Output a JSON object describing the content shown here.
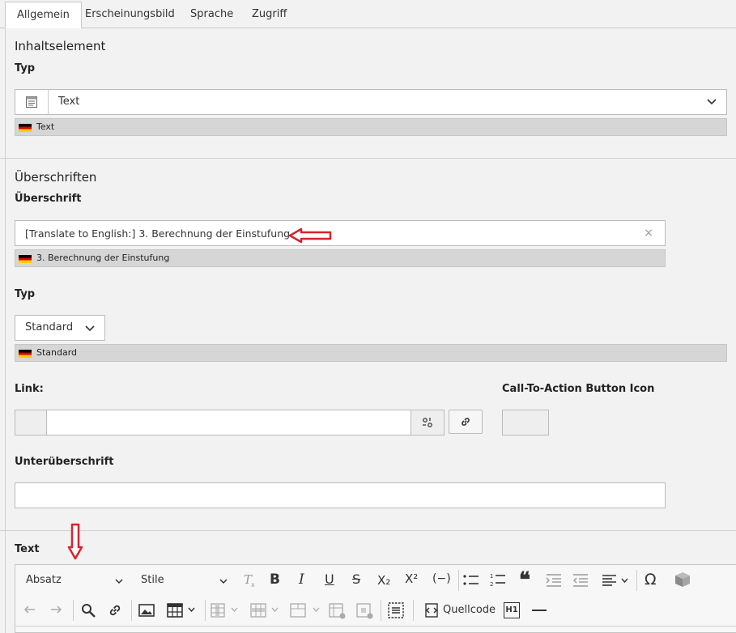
{
  "tabs": [
    {
      "label": "Allgemein",
      "active": true
    },
    {
      "label": "Erscheinungsbild"
    },
    {
      "label": "Sprache"
    },
    {
      "label": "Zugriff"
    }
  ],
  "section_content": {
    "title": "Inhaltselement"
  },
  "type_field": {
    "label": "Typ",
    "value": "Text",
    "fallback": "Text"
  },
  "section_headings": {
    "title": "Überschriften"
  },
  "heading_field": {
    "label": "Überschrift",
    "value": "[Translate to English:] 3. Berechnung der Einstufung",
    "fallback": "3. Berechnung der Einstufung"
  },
  "heading_type": {
    "label": "Typ",
    "value": "Standard",
    "fallback": "Standard"
  },
  "link_field": {
    "label": "Link:",
    "value": ""
  },
  "cta_field": {
    "label": "Call-To-Action Button Icon"
  },
  "subheading_field": {
    "label": "Unterüberschrift",
    "value": ""
  },
  "text_field": {
    "label": "Text"
  },
  "rte": {
    "paragraph_format": "Absatz",
    "styles": "Stile",
    "bold": "B",
    "italic": "I",
    "underline": "U",
    "strike": "S",
    "subscript": "X₂",
    "superscript": "X²",
    "soft_hyphen": "(−)",
    "quote": "❝",
    "omega": "Ω",
    "source_label": "Quellcode",
    "heading_badge": "H1"
  },
  "colors": {
    "accent": "#d9232d",
    "tab_active_bg": "#ffffff",
    "fallback_bg": "#d6d6d6"
  }
}
